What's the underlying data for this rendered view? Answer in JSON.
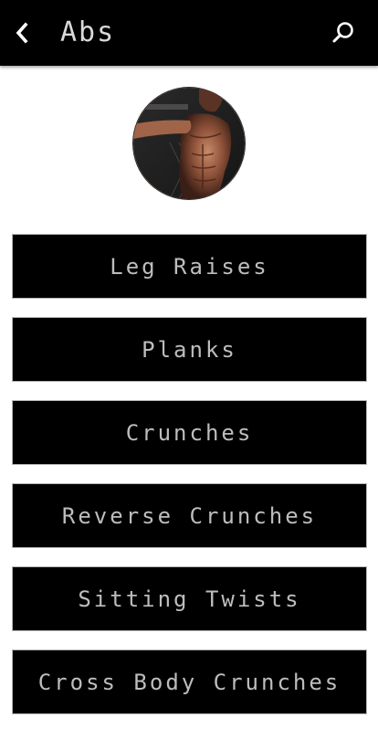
{
  "header": {
    "title": "Abs",
    "back_icon": "chevron-left-icon",
    "search_icon": "search-icon",
    "background_color": "#000000",
    "title_color": "#d9d9d9"
  },
  "avatar": {
    "description_icon": "fitness-avatar"
  },
  "exercises": [
    {
      "label": "Leg Raises"
    },
    {
      "label": "Planks"
    },
    {
      "label": "Crunches"
    },
    {
      "label": "Reverse Crunches"
    },
    {
      "label": "Sitting Twists"
    },
    {
      "label": "Cross Body Crunches"
    }
  ],
  "colors": {
    "button_bg": "#000000",
    "button_text": "#bdbdbd",
    "page_bg": "#ffffff"
  }
}
